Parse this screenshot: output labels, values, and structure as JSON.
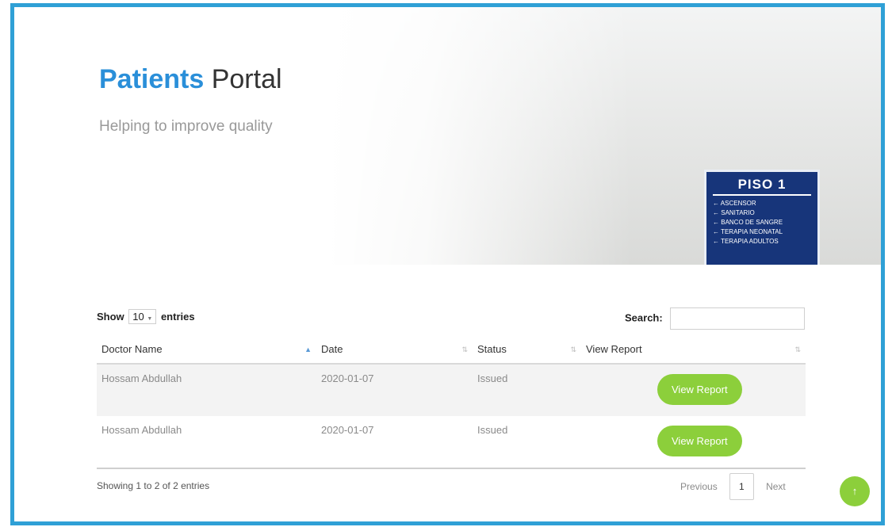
{
  "header": {
    "title_accent": "Patients",
    "title_rest": "Portal",
    "subtitle": "Helping to improve quality"
  },
  "sign": {
    "title": "PISO 1",
    "lines": [
      "ASCENSOR",
      "SANITARIO",
      "BANCO DE SANGRE",
      "TERAPIA NEONATAL",
      "TERAPIA ADULTOS"
    ]
  },
  "table_controls": {
    "show_label": "Show",
    "entries_value": "10",
    "entries_label": "entries",
    "search_label": "Search:",
    "search_value": ""
  },
  "table": {
    "columns": [
      "Doctor Name",
      "Date",
      "Status",
      "View Report"
    ],
    "rows": [
      {
        "doctor": "Hossam Abdullah",
        "date": "2020-01-07",
        "status": "Issued",
        "action": "View Report"
      },
      {
        "doctor": "Hossam Abdullah",
        "date": "2020-01-07",
        "status": "Issued",
        "action": "View Report"
      }
    ]
  },
  "footer": {
    "info": "Showing 1 to 2 of 2 entries",
    "previous": "Previous",
    "page": "1",
    "next": "Next"
  },
  "icons": {
    "sort_asc": "▲",
    "sort_both": "⇅",
    "arrow_left": "←",
    "select_caret": "▼",
    "scroll_top": "↑"
  },
  "colors": {
    "frame": "#2fa0d6",
    "accent": "#2a8fd9",
    "button": "#8ccf3b"
  }
}
